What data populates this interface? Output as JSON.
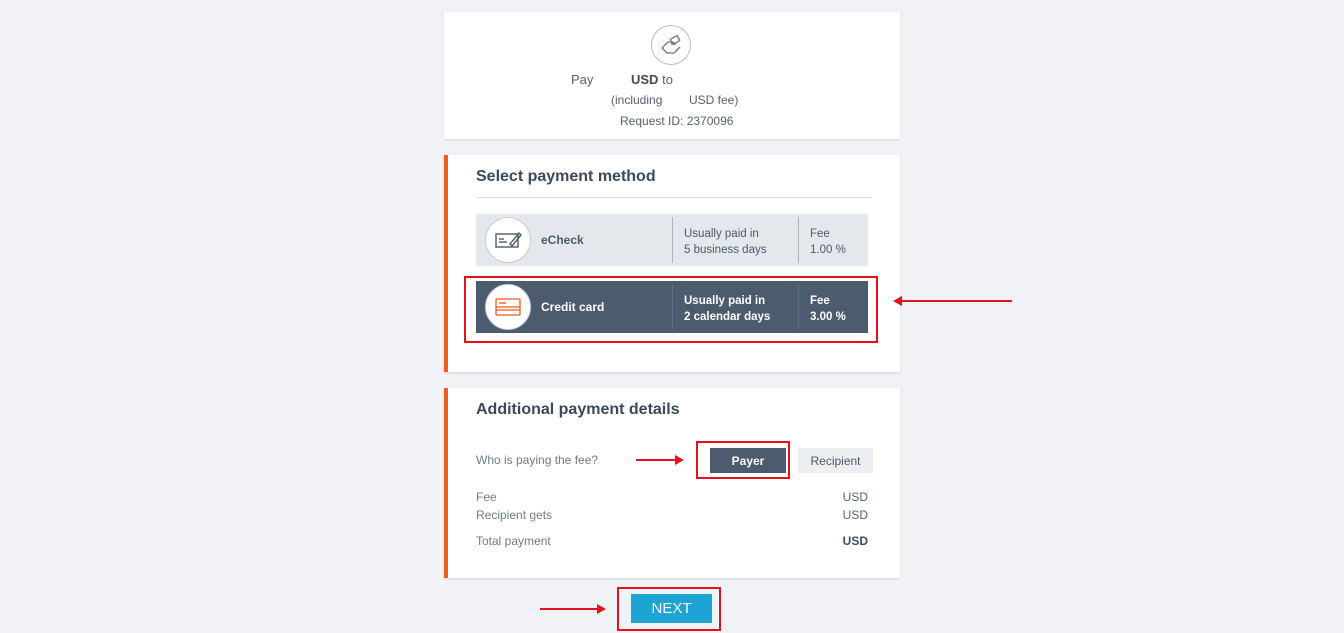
{
  "summary": {
    "icon": "hand-payment-icon",
    "pay_word": "Pay",
    "currency": "USD",
    "to_word": "to",
    "including": "(including",
    "fee_suffix": "USD fee)",
    "request_id": "Request ID: 2370096"
  },
  "payment_method": {
    "title": "Select payment method",
    "methods": [
      {
        "icon": "check-icon",
        "name": "eCheck",
        "time_line1": "Usually paid in",
        "time_line2": "5 business days",
        "fee_label": "Fee",
        "fee_value": "1.00 %",
        "selected": false
      },
      {
        "icon": "credit-card-icon",
        "name": "Credit card",
        "time_line1": "Usually paid in",
        "time_line2": "2 calendar days",
        "fee_label": "Fee",
        "fee_value": "3.00 %",
        "selected": true
      }
    ]
  },
  "details": {
    "title": "Additional payment details",
    "who_pays_label": "Who is paying the fee?",
    "payer_label": "Payer",
    "recipient_label": "Recipient",
    "fee_label": "Fee",
    "fee_value": "USD",
    "recipient_gets_label": "Recipient gets",
    "recipient_gets_value": "USD",
    "total_label": "Total payment",
    "total_value": "USD"
  },
  "next_label": "NEXT",
  "colors": {
    "accent": "#f15a24",
    "selected": "#4c5b6d",
    "button": "#1ea3d5",
    "annotation": "#e3121b"
  }
}
